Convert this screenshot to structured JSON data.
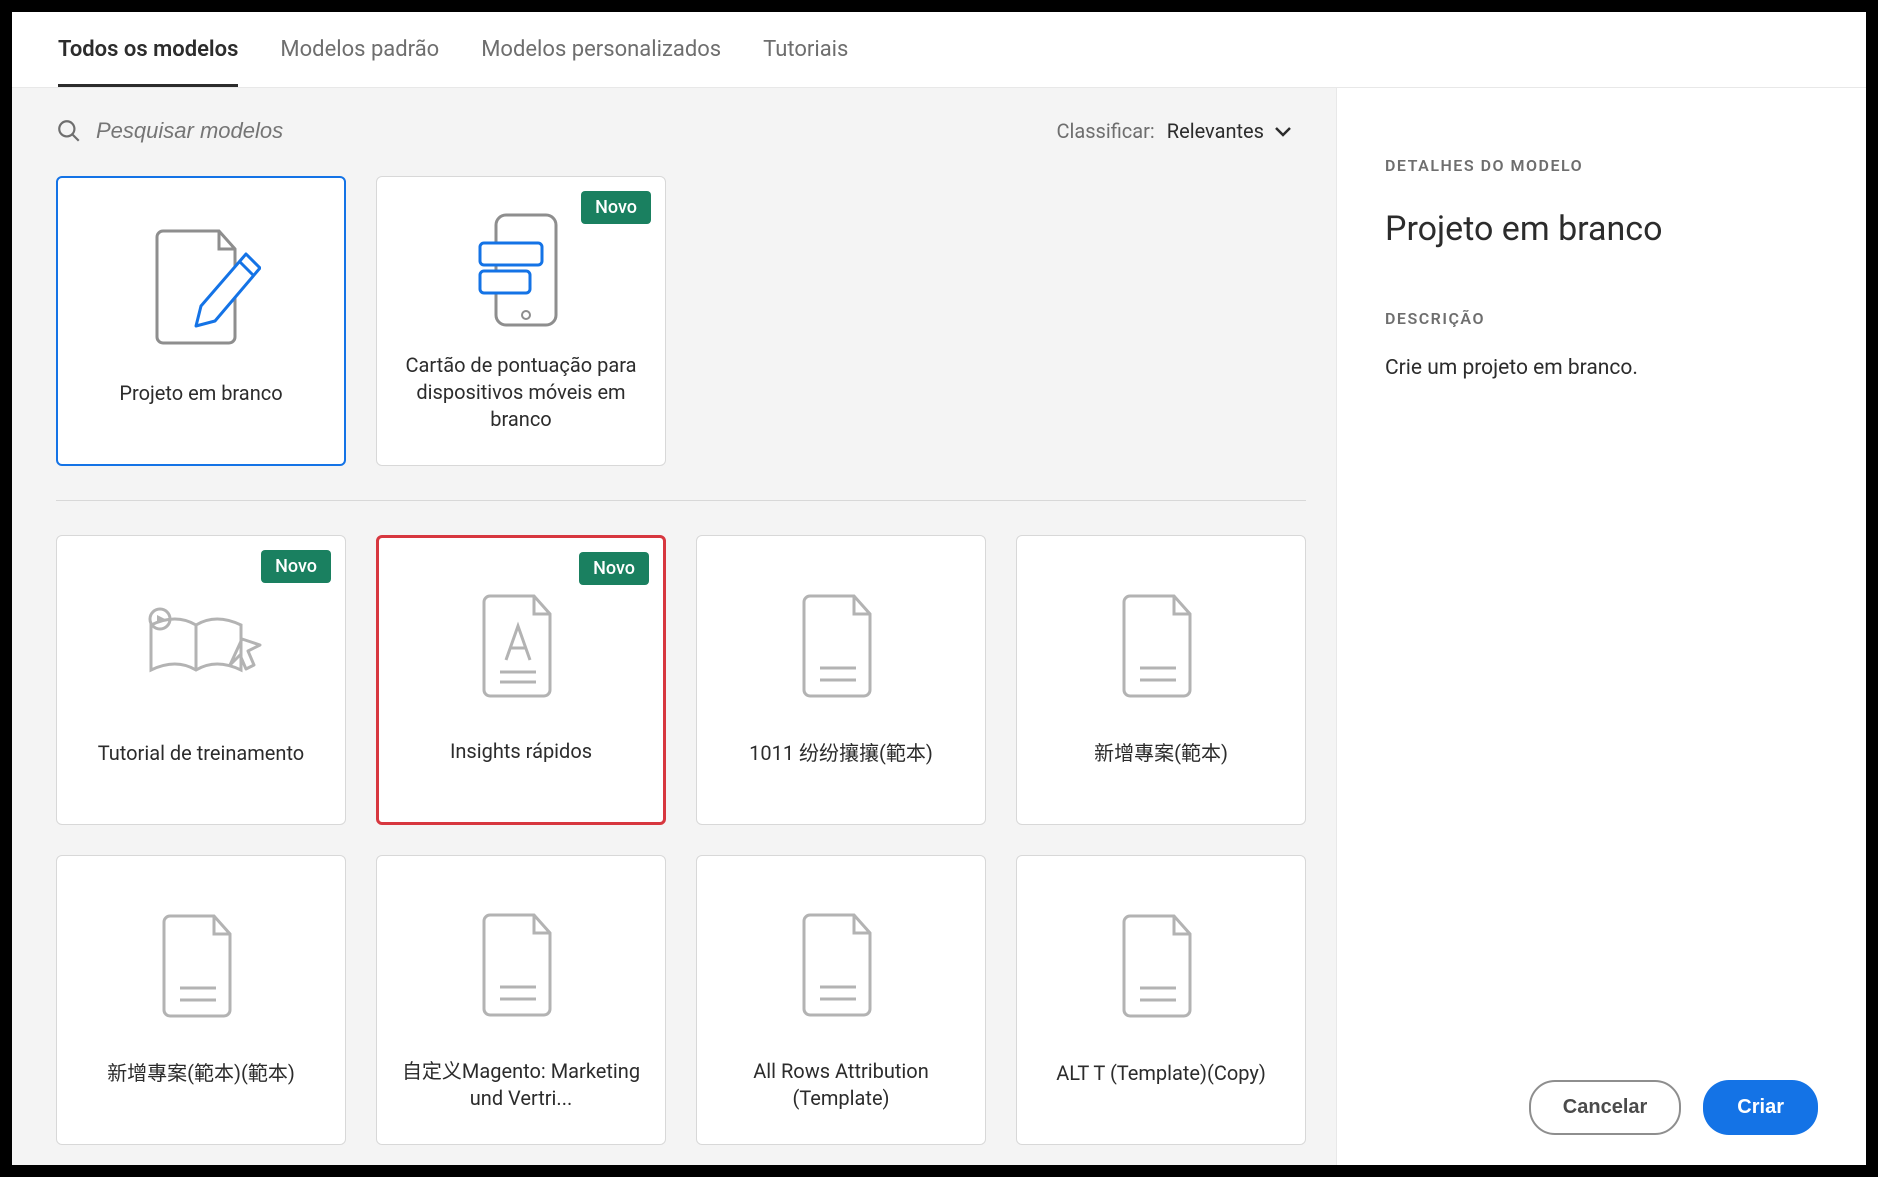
{
  "tabs": [
    {
      "label": "Todos os modelos"
    },
    {
      "label": "Modelos padrão"
    },
    {
      "label": "Modelos personalizados"
    },
    {
      "label": "Tutoriais"
    }
  ],
  "search": {
    "placeholder": "Pesquisar modelos"
  },
  "sort": {
    "label": "Classificar:",
    "value": "Relevantes"
  },
  "badge_label": "Novo",
  "cards_top": [
    {
      "label": "Projeto em branco"
    },
    {
      "label": "Cartão de pontuação para dispositivos móveis em branco"
    }
  ],
  "cards": [
    {
      "label": "Tutorial de treinamento"
    },
    {
      "label": "Insights rápidos"
    },
    {
      "label": "1011 纷纷攘攘(範本)"
    },
    {
      "label": "新增專案(範本)"
    },
    {
      "label": "新增專案(範本)(範本)"
    },
    {
      "label": "自定义Magento: Marketing und Vertri..."
    },
    {
      "label": "All Rows Attribution (Template)"
    },
    {
      "label": "ALT T (Template)(Copy)"
    }
  ],
  "detail": {
    "heading": "DETALHES DO MODELO",
    "title": "Projeto em branco",
    "desc_label": "DESCRIÇÃO",
    "desc": "Crie um projeto em branco."
  },
  "buttons": {
    "cancel": "Cancelar",
    "create": "Criar"
  }
}
